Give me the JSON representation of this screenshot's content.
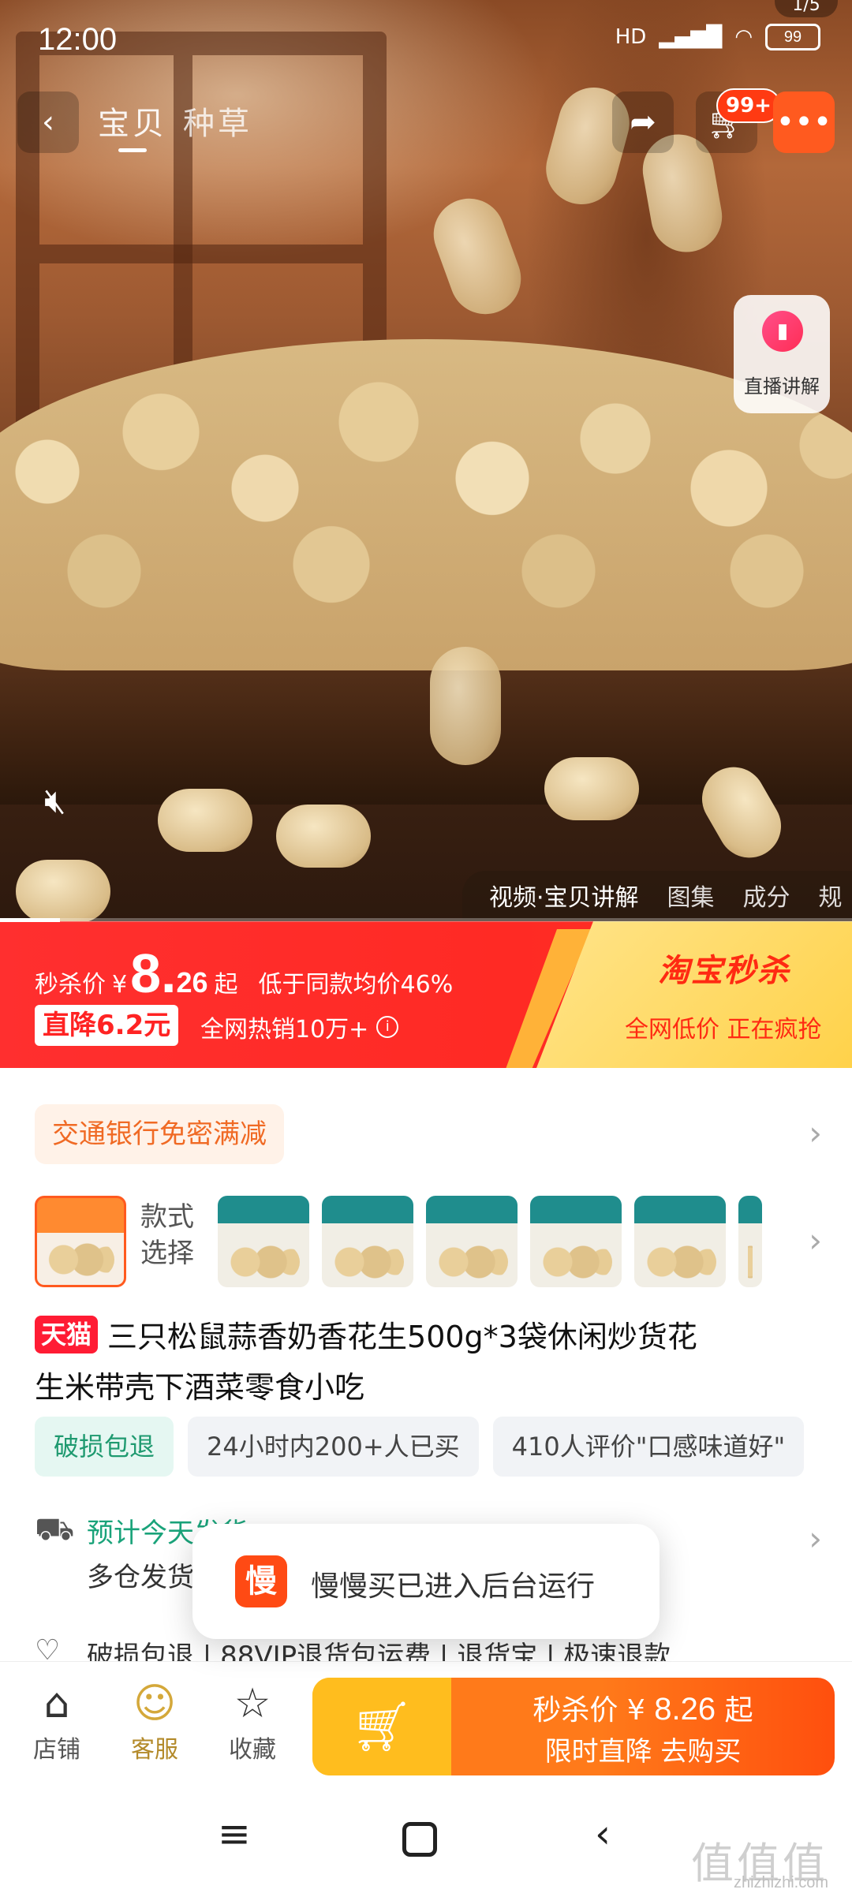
{
  "status_bar": {
    "time": "12:00",
    "network": "HD",
    "battery": "99",
    "corner_counter": "1/5"
  },
  "top_nav": {
    "back_icon": "back-arrow-icon",
    "tabs": [
      {
        "label": "宝贝",
        "active": true
      },
      {
        "label": "种草",
        "active": false
      }
    ],
    "share_icon": "share-icon",
    "cart_icon": "cart-icon",
    "cart_badge": "99+",
    "more_icon": "more-icon"
  },
  "media": {
    "live_explain_label": "直播讲解",
    "mute_icon": "mute-icon",
    "tabs": [
      {
        "label": "视频·宝贝讲解",
        "active": true
      },
      {
        "label": "图集",
        "active": false
      },
      {
        "label": "成分",
        "active": false
      },
      {
        "label": "规",
        "active": false
      }
    ],
    "progress": 0.07
  },
  "flash_sale": {
    "price_prefix": "秒杀价",
    "currency": "¥",
    "price_int": "8.",
    "price_dec": "26",
    "price_suffix": "起",
    "compare_text": "低于同款均价46%",
    "drop_tag": "直降6.2元",
    "hot_sale": "全网热销10万+",
    "brand": "淘宝秒杀",
    "brand_sub": "全网低价 正在疯抢",
    "colors": {
      "banner": "#ff2f2f",
      "accent_yellow": "#ffd24a"
    }
  },
  "product": {
    "bank_promo": "交通银行免密满减",
    "variant_label": "款式选择",
    "tmall_tag": "天猫",
    "title_line1": "三只松鼠蒜香奶香花生500g*3袋休闲炒货花",
    "title_line2": "生米带壳下酒菜零食小吃",
    "features": [
      {
        "label": "破损包退",
        "style": "green"
      },
      {
        "label": "24小时内200+人已买",
        "style": "grey"
      },
      {
        "label": "410人评价\"口感味道好\"",
        "style": "grey"
      }
    ],
    "delivery_line1": "预计今天发货",
    "delivery_line2": "多仓发货",
    "services": "破损包退 | 88VIP退货包运费 | 退货宝 | 极速退款"
  },
  "toast": {
    "logo_text": "慢",
    "message": "慢慢买已进入后台运行"
  },
  "action_bar": {
    "shop_label": "店铺",
    "service_label": "客服",
    "favorite_label": "收藏",
    "buy_price_prefix": "秒杀价",
    "buy_currency": "¥",
    "buy_price": "8.26",
    "buy_suffix": "起",
    "buy_line2": "限时直降 去购买"
  },
  "watermark": {
    "main": "值值值",
    "sub": "zhizhizhi.com"
  }
}
